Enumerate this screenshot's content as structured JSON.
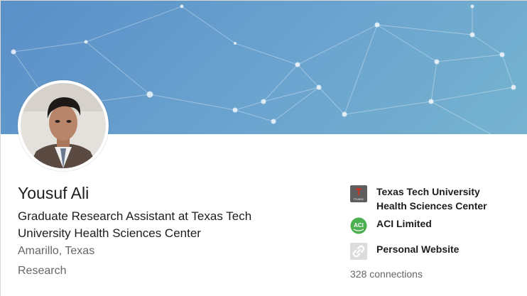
{
  "profile": {
    "name": "Yousuf Ali",
    "headline": "Graduate Research Assistant at Texas Tech University Health Sciences Center",
    "location": "Amarillo, Texas",
    "industry": "Research",
    "connections": "328 connections"
  },
  "side": {
    "items": [
      {
        "label": "Texas Tech University Health Sciences Center",
        "icon": "ttuhsc-logo-icon",
        "logo_text": "TTUHSC"
      },
      {
        "label": "ACI Limited",
        "icon": "aci-logo-icon",
        "logo_text": "ACI"
      },
      {
        "label": "Personal Website",
        "icon": "link-icon"
      }
    ]
  },
  "colors": {
    "banner": "#6a9fcd",
    "aci_green": "#4caf50"
  }
}
